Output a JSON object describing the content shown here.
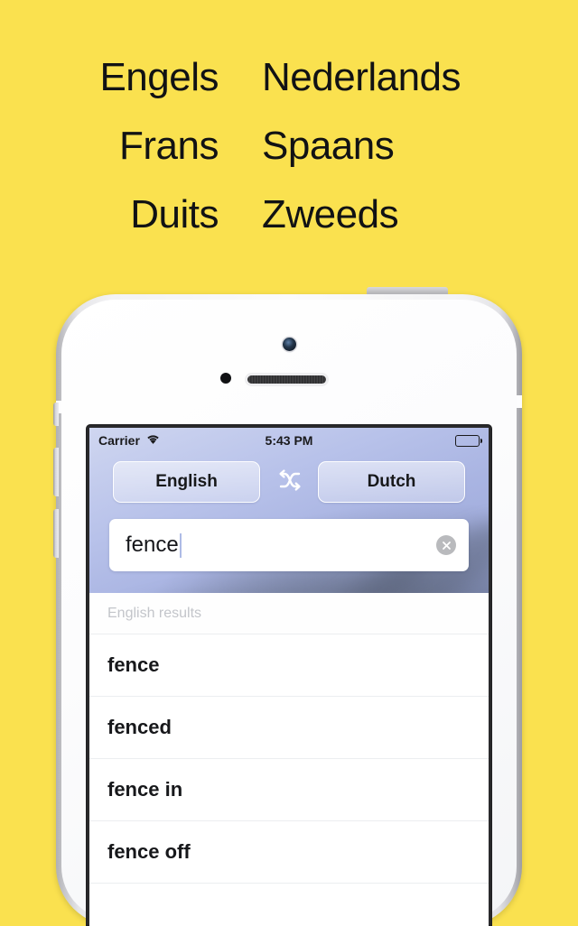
{
  "promo": {
    "rows": [
      {
        "left": "Engels",
        "right": "Nederlands"
      },
      {
        "left": "Frans",
        "right": "Spaans"
      },
      {
        "left": "Duits",
        "right": "Zweeds"
      }
    ]
  },
  "colors": {
    "background_yellow": "#fae14f",
    "promo_text": "#111214",
    "wallpaper_blue": "#a9b4e2",
    "result_text": "#17181b",
    "results_header_text": "#c3c5ca",
    "clear_button_gray": "#b9babd",
    "caret_blue": "#aebbe6"
  },
  "phone": {
    "hardware": {
      "camera": "camera-lens",
      "sensor": "proximity-sensor",
      "speaker": "earpiece-speaker",
      "power_button": "power-button",
      "volume_up": "volume-up-button",
      "volume_down": "volume-down-button",
      "mute_switch": "mute-switch"
    }
  },
  "statusbar": {
    "carrier": "Carrier",
    "wifi_icon": "wifi-icon",
    "time": "5:43 PM",
    "battery_icon": "battery-full-icon"
  },
  "app": {
    "source_language": "English",
    "target_language": "Dutch",
    "swap_icon": "shuffle-swap-icon",
    "search": {
      "value": "fence",
      "placeholder": "",
      "clear_icon": "clear-circle-icon"
    },
    "results": {
      "header": "English results",
      "items": [
        {
          "term": "fence"
        },
        {
          "term": "fenced"
        },
        {
          "term": "fence in"
        },
        {
          "term": "fence off"
        }
      ]
    }
  }
}
